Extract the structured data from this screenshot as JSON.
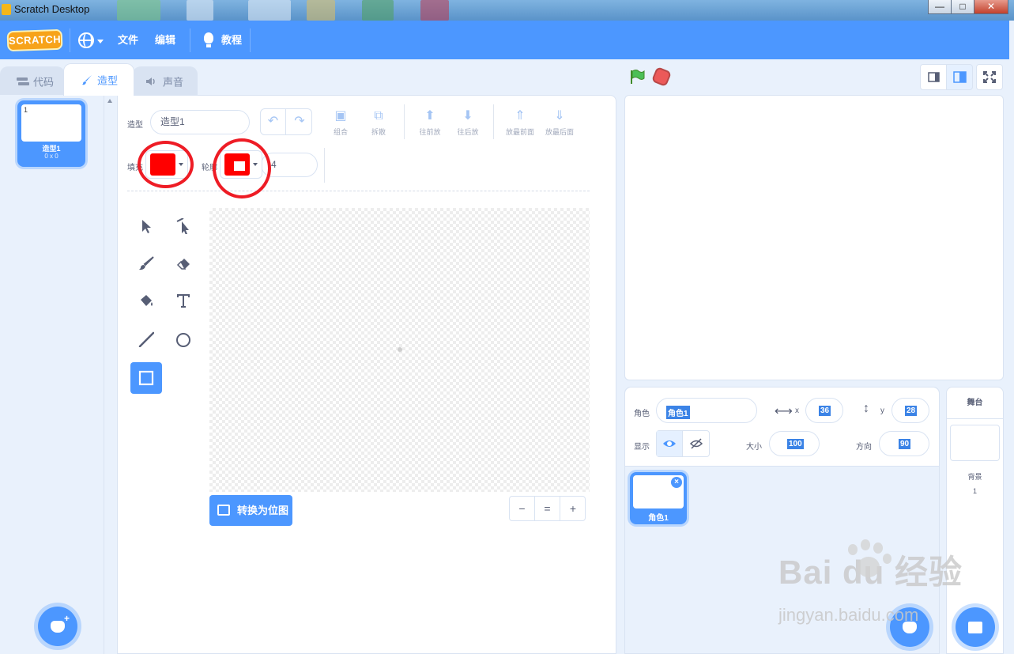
{
  "window": {
    "title": "Scratch Desktop",
    "minimize": "—",
    "maximize": "□",
    "close": "✕"
  },
  "menubar": {
    "logo_text": "SCRATCH",
    "file": "文件",
    "edit": "编辑",
    "tutorials": "教程"
  },
  "tabs": {
    "code": "代码",
    "costumes": "造型",
    "sounds": "声音"
  },
  "costume_list": {
    "items": [
      {
        "number": "1",
        "name": "造型1",
        "size": "0 x 0"
      }
    ]
  },
  "paint": {
    "costume_label": "造型",
    "costume_name": "造型1",
    "actions": {
      "group": "组合",
      "ungroup": "拆散",
      "forward": "往前放",
      "backward": "往后放",
      "front": "放最前面",
      "back": "放最后面"
    },
    "fill_label": "填充",
    "outline_label": "轮廓",
    "fill_color": "#ff0000",
    "outline_color": "#ff0000",
    "outline_width": "4",
    "convert_button": "转换为位图",
    "zoom": {
      "out": "−",
      "reset": "=",
      "in": "+"
    },
    "tools": [
      "select-tool",
      "reshape-tool",
      "brush-tool",
      "eraser-tool",
      "fill-tool",
      "text-tool",
      "line-tool",
      "circle-tool",
      "rectangle-tool"
    ],
    "selected_tool": "rectangle-tool"
  },
  "sprite_info": {
    "sprite_label": "角色",
    "sprite_name": "角色1",
    "x_label": "x",
    "x_value": "36",
    "y_label": "y",
    "y_value": "28",
    "show_label": "显示",
    "size_label": "大小",
    "size_value": "100",
    "direction_label": "方向",
    "direction_value": "90",
    "sprites": [
      {
        "name": "角色1"
      }
    ]
  },
  "stage_pane": {
    "title": "舞台",
    "backdrops_label": "背景",
    "backdrops_count": "1"
  },
  "watermark": {
    "brand": "Bai du 经验",
    "url": "jingyan.baidu.com"
  },
  "colors": {
    "accent": "#4c97ff",
    "annotation": "#ee1c25"
  }
}
